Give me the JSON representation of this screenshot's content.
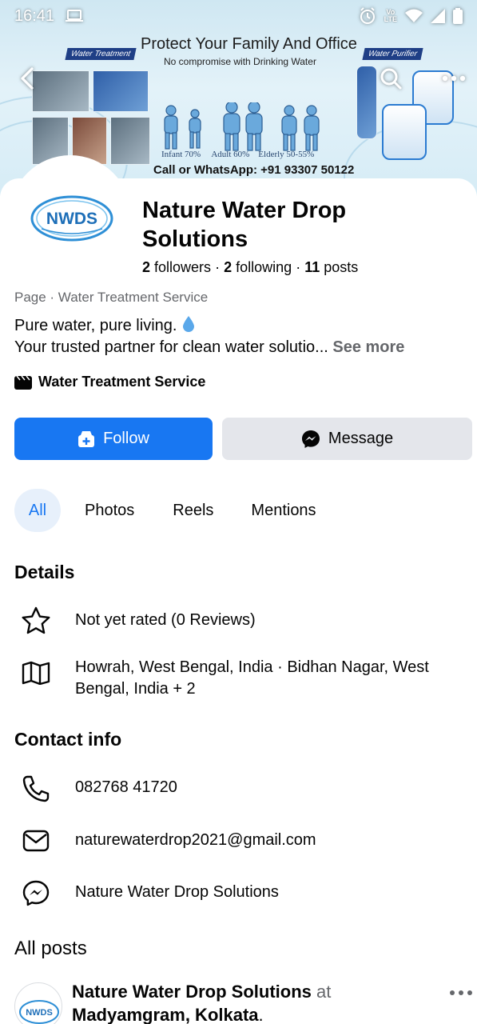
{
  "status_bar": {
    "time": "16:41",
    "network_label_top": "Vo",
    "network_label_bottom": "LTE"
  },
  "cover": {
    "headline": "Protect Your Family And Office",
    "subline": "No compromise with Drinking Water",
    "tag_left": "Water Treatment",
    "tag_right": "Water Purifier",
    "age_labels": "Infant 70%     Adult 60%    Elderly 50-55%",
    "contact_line": "Call or WhatsApp: +91 93307 50122"
  },
  "profile": {
    "logo_text": "NWDS",
    "name_line1": "Nature Water Drop",
    "name_line2": "Solutions",
    "followers_count": "2",
    "followers_label": "followers",
    "following_count": "2",
    "following_label": "following",
    "posts_count": "11",
    "posts_label": "posts",
    "separator": "·",
    "category_line": "Page · Water Treatment Service",
    "bio_line1": "Pure water, pure living.",
    "bio_line2": "Your trusted partner for clean water solutio...",
    "see_more": "See more",
    "service_label": "Water Treatment Service"
  },
  "actions": {
    "follow": "Follow",
    "message": "Message"
  },
  "tabs": [
    "All",
    "Photos",
    "Reels",
    "Mentions"
  ],
  "details": {
    "title": "Details",
    "rating": "Not yet rated (0 Reviews)",
    "location_line1": "Howrah, West Bengal, India · Bidhan Nagar, West",
    "location_line2": "Bengal, India + 2"
  },
  "contact": {
    "title": "Contact info",
    "phone": "082768 41720",
    "email": "naturewaterdrop2021@gmail.com",
    "messenger": "Nature Water Drop Solutions"
  },
  "posts": {
    "title": "All posts",
    "author": "Nature Water Drop Solutions",
    "at": "at",
    "location": "Madyamgram, Kolkata",
    "avatar_text": "NWDS"
  },
  "colors": {
    "accent": "#1877f2",
    "secondary_button": "#e4e6eb",
    "muted_text": "#65676b"
  },
  "icons": [
    "back-arrow-icon",
    "search-icon",
    "more-icon",
    "film-icon",
    "follow-plus-icon",
    "messenger-icon",
    "star-icon",
    "map-icon",
    "phone-icon",
    "email-icon"
  ]
}
